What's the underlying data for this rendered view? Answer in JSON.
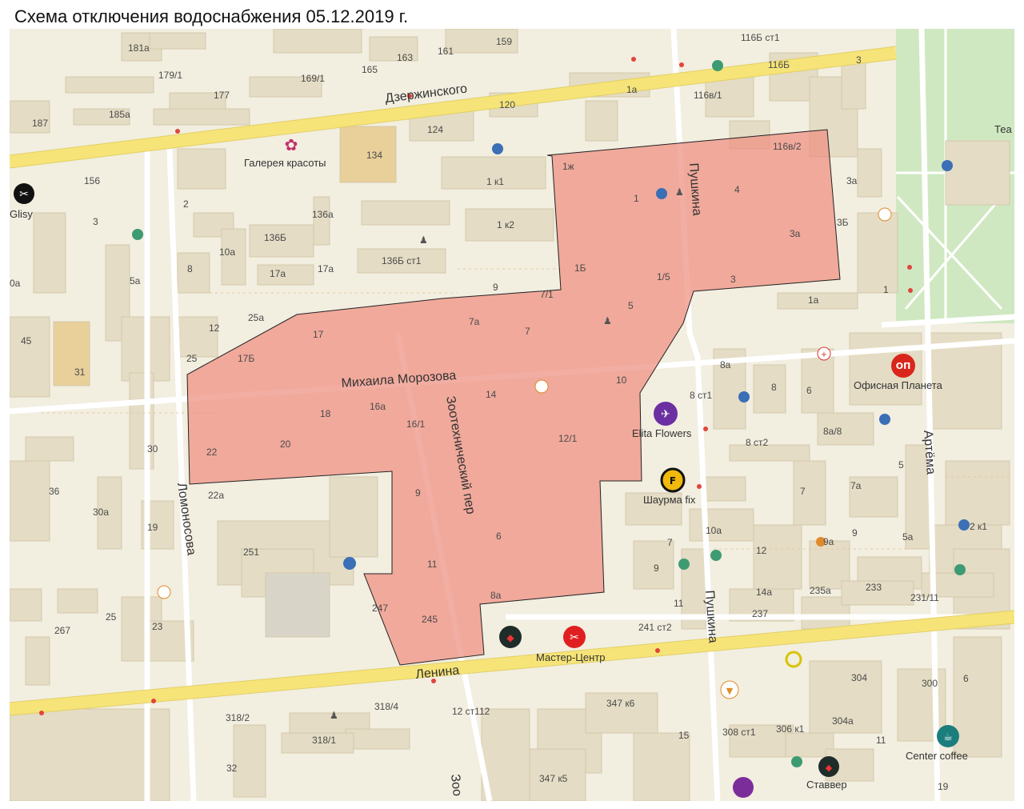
{
  "title": "Схема отключения водоснабжения 05.12.2019 г.",
  "colors": {
    "map_background": "#f2eee0",
    "building": "#e4dcc4",
    "main_road": "#f6e478",
    "minor_road": "#ffffff",
    "park": "#cfe8c1",
    "outage_zone": "#ef8f7f"
  },
  "streets": {
    "dzerzhinskogo": "Дзержинского",
    "mikhaila_morozova": "Михаила Морозова",
    "pushkina_north": "Пушкина",
    "pushkina_south": "Пушкина",
    "lomonosova": "Ломоносова",
    "zootekhnicheskiy": "Зоотехнический пер",
    "lenina": "Ленина",
    "artema": "Артёма",
    "zoo_cut": "Зоо"
  },
  "pois": {
    "gallery": "Галерея красоты",
    "glisy": "Glisy",
    "ofisnaya": "Офисная Планета",
    "ofisnaya_icon_text": "ОП",
    "elita": "Elita Flowers",
    "shaurma": "Шаурма fix",
    "master": "Мастер-Центр",
    "center_coffee": "Center coffee",
    "stavver": "Ставвер",
    "tea_cut": "Теа"
  },
  "house_numbers": {
    "h181a": "181а",
    "h159": "159",
    "h163": "163",
    "h161": "161",
    "h165": "165",
    "h179_1": "179/1",
    "h169_1": "169/1",
    "h177": "177",
    "h185a": "185а",
    "h187": "187",
    "h120": "120",
    "h1a_top": "1а",
    "h124": "124",
    "h134": "134",
    "h156": "156",
    "h2": "2",
    "h3_left": "3",
    "h136a": "136а",
    "h1k1": "1 к1",
    "h1k2": "1 к2",
    "h136b": "136Б",
    "h136b_st1": "136Б ст1",
    "h10a_left": "10а",
    "h8_left": "8",
    "h17a_1": "17а",
    "h17a_2": "17а",
    "h5a": "5а",
    "h0a": "0а",
    "h9_mid": "9",
    "h7_1": "7/1",
    "h25a": "25а",
    "h12_left": "12",
    "h45": "45",
    "h31": "31",
    "h25": "25",
    "h116b_st1": "116Б ст1",
    "h116b": "116Б",
    "h3_right": "3",
    "h116v_1": "116в/1",
    "h116v_2": "116в/2",
    "h1zh": "1ж",
    "h1_center": "1",
    "h4": "4",
    "h3a_right": "3а",
    "h3a_top": "3а",
    "h3b": "3Б",
    "h1b": "1Б",
    "h1_5": "1/5",
    "h3_bottom": "3",
    "h1_right": "1",
    "h1a_right": "1а",
    "h5": "5",
    "h7a": "7а",
    "h7": "7",
    "h17": "17",
    "h17b": "17Б",
    "h10": "10",
    "h14": "14",
    "h18": "18",
    "h16a": "16а",
    "h16_1": "16/1",
    "h20": "20",
    "h22": "22",
    "h12_1": "12/1",
    "h9_zone": "9",
    "h6_zone": "6",
    "h11_zone": "11",
    "h8a_zone": "8а",
    "h247": "247",
    "h245": "245",
    "h22a": "22а",
    "h8a_right": "8а",
    "h8_st1": "8 ст1",
    "h8_right": "8",
    "h6_right": "6",
    "h8a_8": "8а/8",
    "h8_st2": "8 ст2",
    "h5_right": "5",
    "h7_right": "7",
    "h7a_right": "7а",
    "h10a_right": "10а",
    "h12_right": "12",
    "h9a": "9а",
    "h9_right2": "9",
    "h5a_right": "5а",
    "h2k1": "2 к1",
    "h7_small": "7",
    "h9_small": "9",
    "h11_small": "11",
    "h14a": "14а",
    "h235a": "235а",
    "h233": "233",
    "h237": "237",
    "h231_11": "231/11",
    "h241_st2": "241 ст2",
    "h30": "30",
    "h36": "36",
    "h30a": "30а",
    "h19_left": "19",
    "h251": "251",
    "h267": "267",
    "h23": "23",
    "h304": "304",
    "h300": "300",
    "h6_far": "6",
    "h304a": "304а",
    "h308_st1": "308 ст1",
    "h306_k1": "306 к1",
    "h11_bottom": "11",
    "h19_bottom": "19",
    "h347_k6": "347 к6",
    "h347_k5": "347 к5",
    "h15": "15",
    "h318_2": "318/2",
    "h318_4": "318/4",
    "h318_1": "318/1",
    "h12_st112": "12 ст112",
    "h32": "32"
  },
  "icons": [
    "scissors-icon",
    "bank-icon",
    "beauty-icon",
    "education-icon",
    "monument-icon",
    "cafe-icon",
    "restaurant-icon",
    "theatre-icon",
    "hospital-icon",
    "flowers-icon",
    "fastfood-icon",
    "repair-icon",
    "coffee-icon",
    "pizza-icon",
    "shop-icon",
    "bus-stop-icon"
  ]
}
